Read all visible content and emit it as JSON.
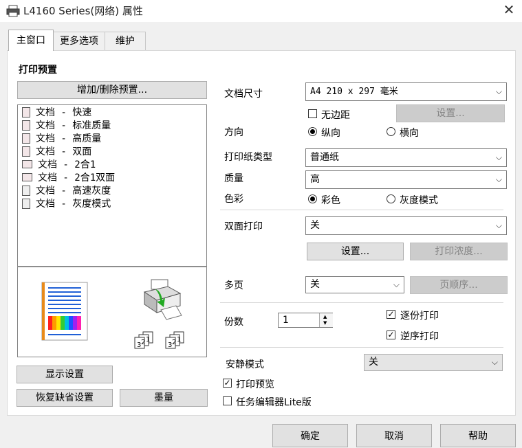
{
  "window": {
    "title": "L4160 Series(网络) 属性",
    "close": "✕"
  },
  "tabs": [
    "主窗口",
    "更多选项",
    "维护"
  ],
  "presets": {
    "heading": "打印预置",
    "add_remove": "增加/删除预置...",
    "items": [
      "文档 - 快速",
      "文档 - 标准质量",
      "文档 - 高质量",
      "文档 - 双面",
      "文档 - 2合1",
      "文档 - 2合1双面",
      "文档 - 高速灰度",
      "文档 - 灰度模式"
    ],
    "collate_numbers": [
      "3",
      "2",
      "1"
    ]
  },
  "left_buttons": {
    "show_settings": "显示设置",
    "restore_defaults": "恢复缺省设置",
    "ink_levels": "墨量"
  },
  "settings": {
    "paper_size_label": "文档尺寸",
    "paper_size_value": "A4 210 x 297 毫米",
    "borderless_label": "无边距",
    "settings_btn": "设置...",
    "orientation_label": "方向",
    "portrait": "纵向",
    "landscape": "横向",
    "paper_type_label": "打印纸类型",
    "paper_type_value": "普通纸",
    "quality_label": "质量",
    "quality_value": "高",
    "color_label": "色彩",
    "color": "彩色",
    "grayscale": "灰度模式",
    "duplex_label": "双面打印",
    "duplex_value": "关",
    "duplex_settings_btn": "设置...",
    "density_btn": "打印浓度...",
    "multipage_label": "多页",
    "multipage_value": "关",
    "page_order_btn": "页顺序...",
    "copies_label": "份数",
    "copies_value": "1",
    "collate_label": "逐份打印",
    "reverse_label": "逆序打印",
    "quiet_label": "安静模式",
    "quiet_value": "关",
    "print_preview_label": "打印预览",
    "job_arranger_label": "任务编辑器Lite版"
  },
  "dialog_buttons": {
    "ok": "确定",
    "cancel": "取消",
    "help": "帮助"
  },
  "colors": {
    "accent_blue": "#1f5fd6",
    "page_border": "#e88a1a"
  }
}
